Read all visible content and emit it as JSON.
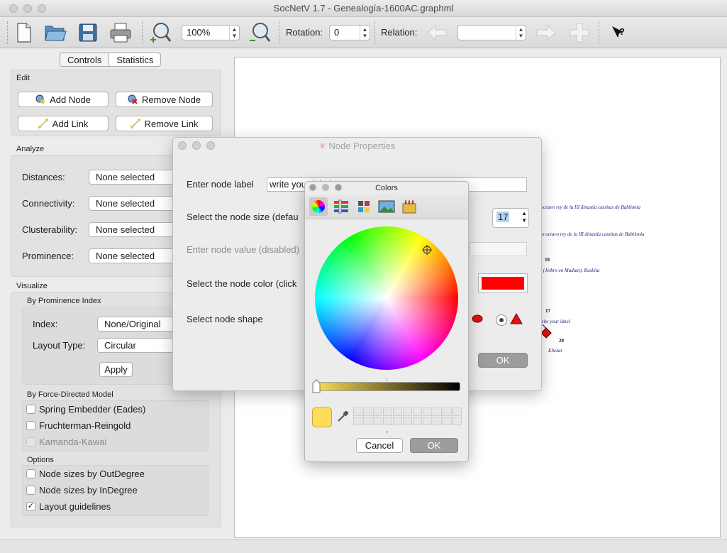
{
  "window": {
    "title": "SocNetV 1.7 - Genealogía-1600AC.graphml"
  },
  "toolbar": {
    "zoom_value": "100%",
    "rotation_label": "Rotation:",
    "rotation_value": "0",
    "relation_label": "Relation:",
    "relation_value": "",
    "icons": [
      "new-file-icon",
      "open-folder-icon",
      "save-icon",
      "print-icon",
      "zoom-in-icon",
      "zoom-out-icon",
      "arrow-left-icon",
      "arrow-right-icon",
      "plus-icon",
      "whats-this-icon"
    ]
  },
  "dock": {
    "tabs": [
      "Controls",
      "Statistics"
    ],
    "edit": {
      "title": "Edit",
      "add_node": "Add Node",
      "remove_node": "Remove Node",
      "add_link": "Add Link",
      "remove_link": "Remove Link"
    },
    "analyze": {
      "title": "Analyze",
      "rows": [
        {
          "label": "Distances:",
          "value": "None selected"
        },
        {
          "label": "Connectivity:",
          "value": "None selected"
        },
        {
          "label": "Clusterability:",
          "value": "None selected"
        },
        {
          "label": "Prominence:",
          "value": "None selected"
        }
      ]
    },
    "visualize": {
      "title": "Visualize",
      "prominence_title": "By Prominence Index",
      "index_label": "Index:",
      "index_value": "None/Original",
      "layout_label": "Layout Type:",
      "layout_value": "Circular",
      "apply": "Apply",
      "force_title": "By Force-Directed Model",
      "force_items": [
        {
          "label": "Spring Embedder (Eades)",
          "checked": false,
          "enabled": true
        },
        {
          "label": "Fruchterman-Reingold",
          "checked": false,
          "enabled": true
        },
        {
          "label": "Kamanda-Kawai",
          "checked": false,
          "enabled": false
        }
      ],
      "options_title": "Options",
      "option_items": [
        {
          "label": "Node sizes by OutDegree",
          "checked": false
        },
        {
          "label": "Node sizes by InDegree",
          "checked": false
        },
        {
          "label": "Layout guidelines",
          "checked": true
        }
      ]
    }
  },
  "canvas": {
    "texts": [
      "onceavo rey de la III dinastía cassitas de Babilonia",
      "mo octavo rey de la III dinastía cassitas de Babilonia",
      "el (Jethro en Madian), Kushita",
      "write your label",
      "Eliezar"
    ],
    "numbers": [
      "18",
      "17",
      "20"
    ],
    "colors": {
      "node": "#e01010",
      "text": "#1b1b7a"
    }
  },
  "node_properties": {
    "title": "Node Properties",
    "label_prompt": "Enter node label",
    "label_value": "write your label",
    "size_prompt": "Select the node size (defau",
    "size_value": "17",
    "value_prompt": "Enter node value (disabled)",
    "color_prompt": "Select the node color (click",
    "color_value": "#ff0000",
    "shape_prompt": "Select node shape",
    "ok": "OK"
  },
  "colors_panel": {
    "title": "Colors",
    "modes": [
      "color-wheel-icon",
      "color-sliders-icon",
      "color-palettes-icon",
      "image-palettes-icon",
      "crayons-icon"
    ],
    "current_color": "#fedd5b",
    "cancel": "Cancel",
    "ok": "OK"
  }
}
